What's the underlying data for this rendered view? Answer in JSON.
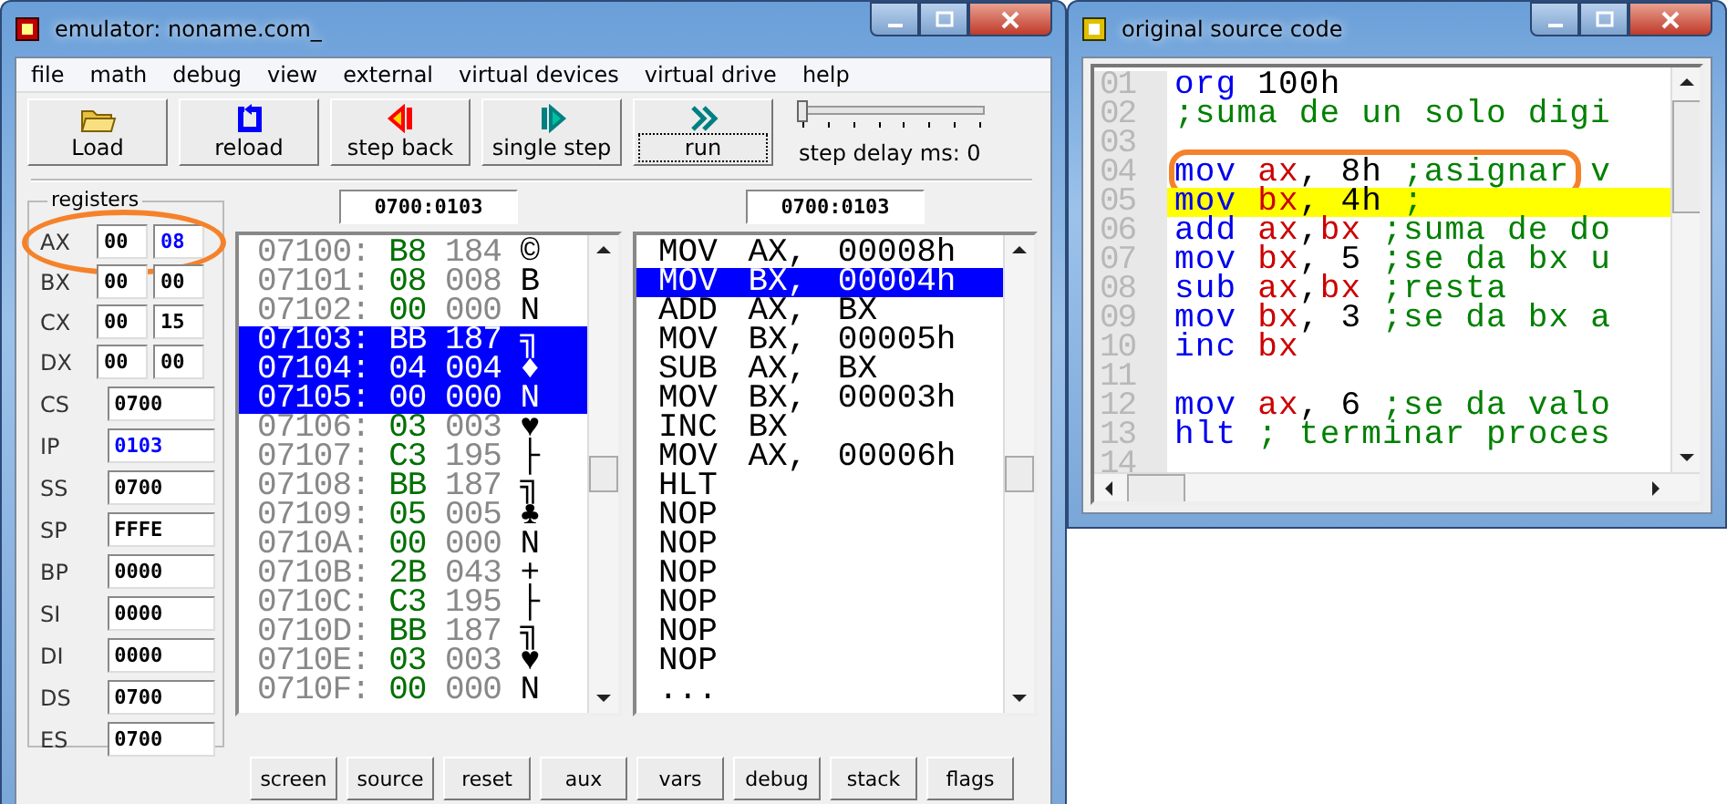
{
  "emulator": {
    "title": "emulator: noname.com_",
    "menu": [
      "file",
      "math",
      "debug",
      "view",
      "external",
      "virtual devices",
      "virtual drive",
      "help"
    ],
    "toolbar": [
      {
        "label": "Load",
        "kind": "load",
        "focused": false
      },
      {
        "label": "reload",
        "kind": "reload",
        "focused": false
      },
      {
        "label": "step back",
        "kind": "back",
        "focused": false
      },
      {
        "label": "single step",
        "kind": "step",
        "focused": false
      },
      {
        "label": "run",
        "kind": "run",
        "focused": true
      }
    ],
    "step_delay": {
      "label": "step delay ms: 0",
      "level": 0
    },
    "registers": {
      "title": "registers",
      "items": [
        {
          "name": "AX",
          "kind": "split",
          "circled": true,
          "values": [
            {
              "text": "00",
              "changed": false
            },
            {
              "text": "08",
              "changed": true
            }
          ]
        },
        {
          "name": "BX",
          "kind": "split",
          "circled": false,
          "values": [
            {
              "text": "00",
              "changed": false
            },
            {
              "text": "00",
              "changed": false
            }
          ]
        },
        {
          "name": "CX",
          "kind": "split",
          "circled": false,
          "values": [
            {
              "text": "00",
              "changed": false
            },
            {
              "text": "15",
              "changed": false
            }
          ]
        },
        {
          "name": "DX",
          "kind": "split",
          "circled": false,
          "values": [
            {
              "text": "00",
              "changed": false
            },
            {
              "text": "00",
              "changed": false
            }
          ]
        },
        {
          "name": "CS",
          "kind": "word",
          "circled": false,
          "values": [
            {
              "text": "0700",
              "changed": false
            }
          ]
        },
        {
          "name": "IP",
          "kind": "word",
          "circled": false,
          "values": [
            {
              "text": "0103",
              "changed": true
            }
          ]
        },
        {
          "name": "SS",
          "kind": "word",
          "circled": false,
          "values": [
            {
              "text": "0700",
              "changed": false
            }
          ]
        },
        {
          "name": "SP",
          "kind": "word",
          "circled": false,
          "values": [
            {
              "text": "FFFE",
              "changed": false
            }
          ]
        },
        {
          "name": "BP",
          "kind": "word",
          "circled": false,
          "values": [
            {
              "text": "0000",
              "changed": false
            }
          ]
        },
        {
          "name": "SI",
          "kind": "word",
          "circled": false,
          "values": [
            {
              "text": "0000",
              "changed": false
            }
          ]
        },
        {
          "name": "DI",
          "kind": "word",
          "circled": false,
          "values": [
            {
              "text": "0000",
              "changed": false
            }
          ]
        },
        {
          "name": "DS",
          "kind": "word",
          "circled": false,
          "values": [
            {
              "text": "0700",
              "changed": false
            }
          ]
        },
        {
          "name": "ES",
          "kind": "word",
          "circled": false,
          "values": [
            {
              "text": "0700",
              "changed": false
            }
          ]
        }
      ]
    },
    "memory_address": "0700:0103",
    "memory": [
      {
        "address": "07100:",
        "hex": "B8",
        "dec": "184",
        "char": "©",
        "selected": false
      },
      {
        "address": "07101:",
        "hex": "08",
        "dec": "008",
        "char": "B",
        "selected": false
      },
      {
        "address": "07102:",
        "hex": "00",
        "dec": "000",
        "char": "N",
        "selected": false
      },
      {
        "address": "07103:",
        "hex": "BB",
        "dec": "187",
        "char": "╗",
        "selected": true
      },
      {
        "address": "07104:",
        "hex": "04",
        "dec": "004",
        "char": "♦",
        "selected": true
      },
      {
        "address": "07105:",
        "hex": "00",
        "dec": "000",
        "char": "N",
        "selected": true
      },
      {
        "address": "07106:",
        "hex": "03",
        "dec": "003",
        "char": "♥",
        "selected": false
      },
      {
        "address": "07107:",
        "hex": "C3",
        "dec": "195",
        "char": "├",
        "selected": false
      },
      {
        "address": "07108:",
        "hex": "BB",
        "dec": "187",
        "char": "╗",
        "selected": false
      },
      {
        "address": "07109:",
        "hex": "05",
        "dec": "005",
        "char": "♣",
        "selected": false
      },
      {
        "address": "0710A:",
        "hex": "00",
        "dec": "000",
        "char": "N",
        "selected": false
      },
      {
        "address": "0710B:",
        "hex": "2B",
        "dec": "043",
        "char": "+",
        "selected": false
      },
      {
        "address": "0710C:",
        "hex": "C3",
        "dec": "195",
        "char": "├",
        "selected": false
      },
      {
        "address": "0710D:",
        "hex": "BB",
        "dec": "187",
        "char": "╗",
        "selected": false
      },
      {
        "address": "0710E:",
        "hex": "03",
        "dec": "003",
        "char": "♥",
        "selected": false
      },
      {
        "address": "0710F:",
        "hex": "00",
        "dec": "000",
        "char": "N",
        "selected": false
      }
    ],
    "disassembly_address": "0700:0103",
    "disassembly": [
      {
        "text": "MOV AX, 00008h",
        "selected": false
      },
      {
        "text": "MOV BX, 00004h",
        "selected": true
      },
      {
        "text": "ADD AX, BX",
        "selected": false
      },
      {
        "text": "MOV BX, 00005h",
        "selected": false
      },
      {
        "text": "SUB AX, BX",
        "selected": false
      },
      {
        "text": "MOV BX, 00003h",
        "selected": false
      },
      {
        "text": "INC BX",
        "selected": false
      },
      {
        "text": "MOV AX, 00006h",
        "selected": false
      },
      {
        "text": "HLT",
        "selected": false
      },
      {
        "text": "NOP",
        "selected": false
      },
      {
        "text": "NOP",
        "selected": false
      },
      {
        "text": "NOP",
        "selected": false
      },
      {
        "text": "NOP",
        "selected": false
      },
      {
        "text": "NOP",
        "selected": false
      },
      {
        "text": "NOP",
        "selected": false
      },
      {
        "text": "...",
        "selected": false
      }
    ],
    "bottom_buttons": [
      "screen",
      "source",
      "reset",
      "aux",
      "vars",
      "debug",
      "stack",
      "flags"
    ]
  },
  "source": {
    "title": "original source code",
    "lines": [
      {
        "number": "01",
        "selected": false,
        "circled": false,
        "tokens": [
          {
            "text": "org",
            "kind": "keyword"
          },
          {
            "text": " 100h",
            "kind": "plain"
          }
        ]
      },
      {
        "number": "02",
        "selected": false,
        "circled": false,
        "tokens": [
          {
            "text": ";suma de un solo digi",
            "kind": "comment"
          }
        ]
      },
      {
        "number": "03",
        "selected": false,
        "circled": false
      },
      {
        "number": "04",
        "selected": false,
        "circled": true,
        "tokens": [
          {
            "text": "mov",
            "kind": "keyword"
          },
          {
            "text": " ax",
            "kind": "register"
          },
          {
            "text": ", 8h ",
            "kind": "plain"
          },
          {
            "text": ";asignar v",
            "kind": "comment"
          }
        ]
      },
      {
        "number": "05",
        "selected": true,
        "circled": false,
        "tokens": [
          {
            "text": "mov",
            "kind": "keyword"
          },
          {
            "text": " bx",
            "kind": "register"
          },
          {
            "text": ", 4h ",
            "kind": "plain"
          },
          {
            "text": ";",
            "kind": "comment"
          }
        ]
      },
      {
        "number": "06",
        "selected": false,
        "circled": false,
        "tokens": [
          {
            "text": "add",
            "kind": "keyword"
          },
          {
            "text": " ax",
            "kind": "register"
          },
          {
            "text": ",",
            "kind": "plain"
          },
          {
            "text": "bx",
            "kind": "register"
          },
          {
            "text": " ;suma de do",
            "kind": "comment"
          }
        ]
      },
      {
        "number": "07",
        "selected": false,
        "circled": false,
        "tokens": [
          {
            "text": "mov",
            "kind": "keyword"
          },
          {
            "text": " bx",
            "kind": "register"
          },
          {
            "text": ", 5 ",
            "kind": "plain"
          },
          {
            "text": ";se da bx u",
            "kind": "comment"
          }
        ]
      },
      {
        "number": "08",
        "selected": false,
        "circled": false,
        "tokens": [
          {
            "text": "sub",
            "kind": "keyword"
          },
          {
            "text": " ax",
            "kind": "register"
          },
          {
            "text": ",",
            "kind": "plain"
          },
          {
            "text": "bx",
            "kind": "register"
          },
          {
            "text": " ;resta",
            "kind": "comment"
          }
        ]
      },
      {
        "number": "09",
        "selected": false,
        "circled": false,
        "tokens": [
          {
            "text": "mov",
            "kind": "keyword"
          },
          {
            "text": " bx",
            "kind": "register"
          },
          {
            "text": ", 3 ",
            "kind": "plain"
          },
          {
            "text": ";se da bx a",
            "kind": "comment"
          }
        ]
      },
      {
        "number": "10",
        "selected": false,
        "circled": false,
        "tokens": [
          {
            "text": "inc",
            "kind": "keyword"
          },
          {
            "text": " bx",
            "kind": "register"
          }
        ]
      },
      {
        "number": "11",
        "selected": false,
        "circled": false
      },
      {
        "number": "12",
        "selected": false,
        "circled": false,
        "tokens": [
          {
            "text": "mov",
            "kind": "keyword"
          },
          {
            "text": " ax",
            "kind": "register"
          },
          {
            "text": ", 6 ",
            "kind": "plain"
          },
          {
            "text": ";se da valo",
            "kind": "comment"
          }
        ]
      },
      {
        "number": "13",
        "selected": false,
        "circled": false,
        "tokens": [
          {
            "text": "hlt",
            "kind": "keyword"
          },
          {
            "text": " ; terminar proces",
            "kind": "comment"
          }
        ]
      },
      {
        "number": "14",
        "selected": false,
        "circled": false
      }
    ]
  }
}
